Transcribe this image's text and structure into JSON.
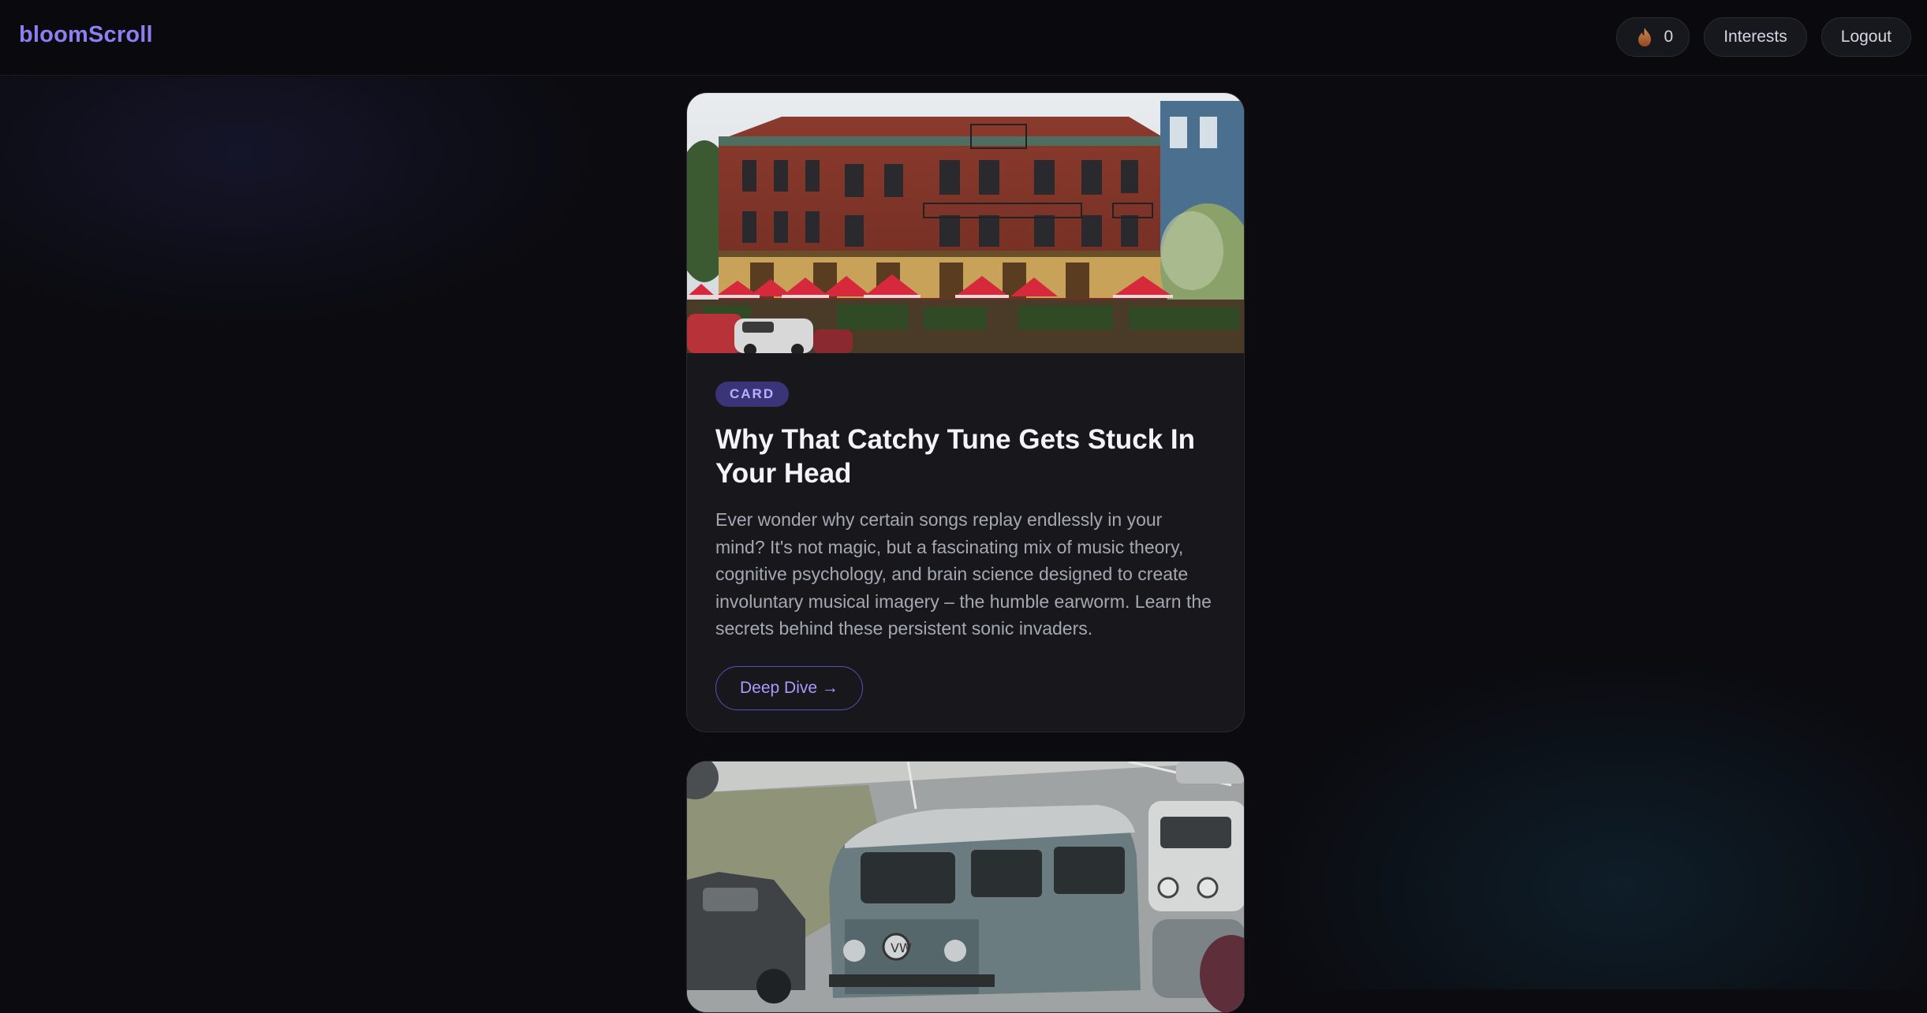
{
  "app": {
    "name": "bloomScroll"
  },
  "header": {
    "streak_count": "0",
    "streak_icon": "flame-icon",
    "interests_label": "Interests",
    "logout_label": "Logout"
  },
  "feed": {
    "cards": [
      {
        "badge": "CARD",
        "title": "Why That Catchy Tune Gets Stuck In Your Head",
        "description": "Ever wonder why certain songs replay endlessly in your mind? It's not magic, but a fascinating mix of music theory, cognitive psychology, and brain science designed to create involuntary musical imagery – the humble earworm. Learn the secrets behind these persistent sonic invaders.",
        "cta_label": "Deep Dive →"
      }
    ]
  },
  "colors": {
    "accent": "#8b7ff2",
    "background": "#0b0b10",
    "card": "#17171c",
    "badge_bg": "#3a3478"
  }
}
